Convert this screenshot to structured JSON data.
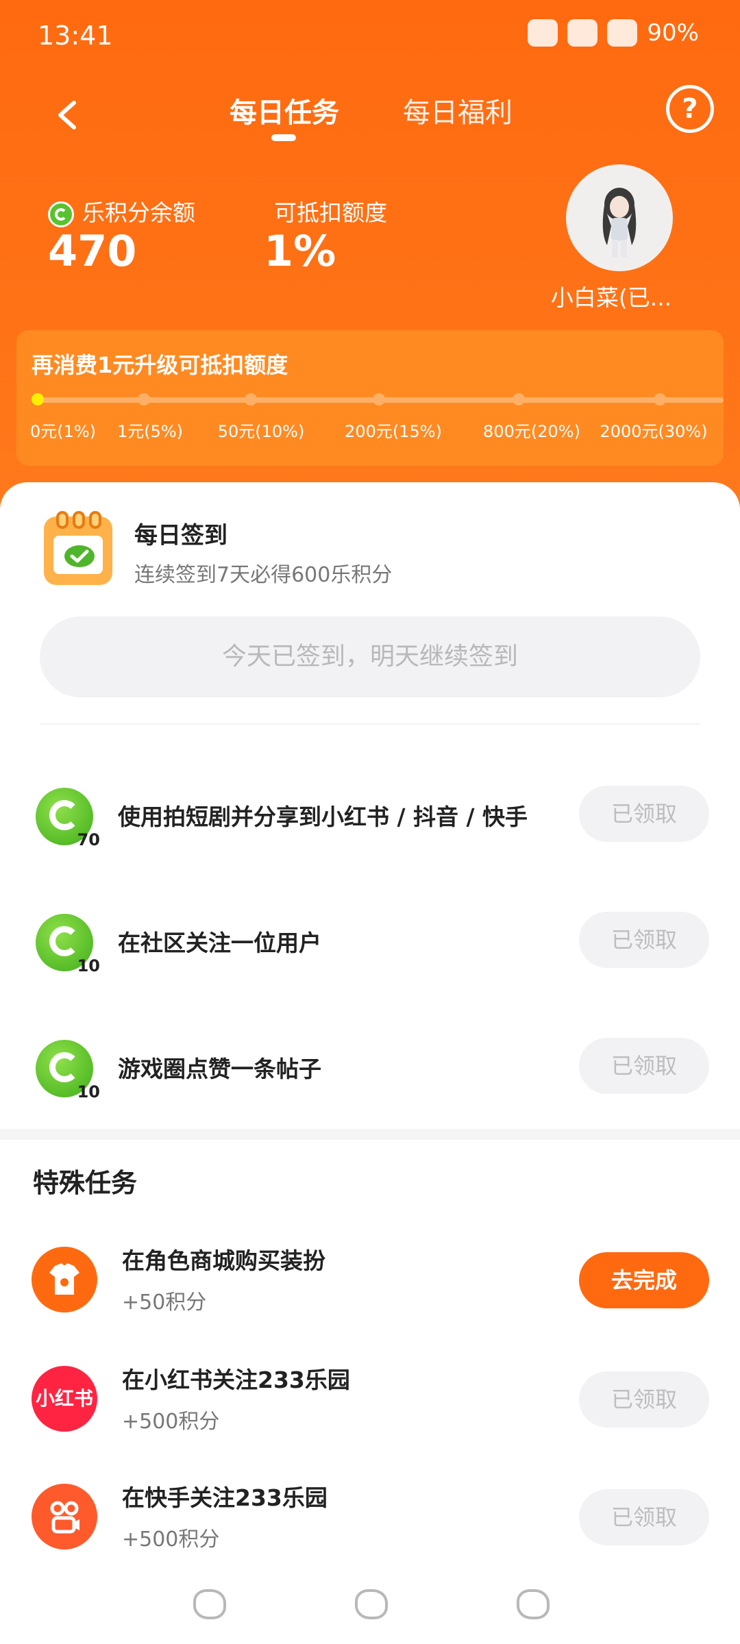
{
  "status_bar": {
    "time": "13:41",
    "battery": "90%"
  },
  "nav": {
    "tabs": [
      "每日任务",
      "每日福利"
    ],
    "active_tab": "每日任务",
    "help_label": "?"
  },
  "header": {
    "points_label": "乐积分余额",
    "points_value": "470",
    "deduct_label": "可抵扣额度",
    "deduct_value": "1%",
    "username": "小白菜(已..."
  },
  "level": {
    "title": "再消费1元升级可抵扣额度",
    "ticks": [
      "0元(1%)",
      "1元(5%)",
      "50元(10%)",
      "200元(15%)",
      "800元(20%)",
      "2000元(30%)"
    ],
    "active_index": 0
  },
  "signin": {
    "title": "每日签到",
    "subtitle": "连续签到7天必得600乐积分",
    "button": "今天已签到，明天继续签到"
  },
  "daily_tasks": [
    {
      "label": "使用拍短剧并分享到小红书 / 抖音 / 快手",
      "points": "70",
      "button": "已领取"
    },
    {
      "label": "在社区关注一位用户",
      "points": "10",
      "button": "已领取"
    },
    {
      "label": "游戏圈点赞一条帖子",
      "points": "10",
      "button": "已领取"
    }
  ],
  "special": {
    "title": "特殊任务",
    "items": [
      {
        "title": "在角色商城购买装扮",
        "reward": "+50积分",
        "button": "去完成",
        "icon": "shirt-icon",
        "color": "#ff6a10"
      },
      {
        "title": "在小红书关注233乐园",
        "reward": "+500积分",
        "button": "已领取",
        "icon": "xiaohongshu-icon",
        "icon_text": "小红书",
        "color": "#ff2442"
      },
      {
        "title": "在快手关注233乐园",
        "reward": "+500积分",
        "button": "已领取",
        "icon": "kuaishou-icon",
        "color": "#ff5a2c"
      }
    ]
  },
  "colors": {
    "brand": "#ff6a10",
    "coin": "#4fb52a"
  }
}
